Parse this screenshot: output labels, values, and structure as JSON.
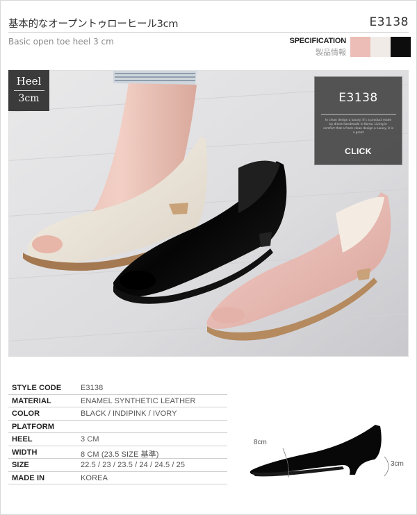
{
  "header": {
    "title_jp": "基本的なオープントゥローヒール3cm",
    "code": "E3138",
    "title_en": "Basic open toe heel 3 cm"
  },
  "specification": {
    "label_en": "SPECIFICATION",
    "label_jp": "製品情報",
    "swatches": [
      "#ecbcb6",
      "#f1ebe8",
      "#0d0d0d"
    ]
  },
  "photo": {
    "heel_badge": {
      "line1": "Heel",
      "line2": "3cm"
    },
    "panel": {
      "code": "E3138",
      "small_text": "In clean design a luxury. It's a product made by direct handmade in Korea. Living in comfort that a fresh clean design a luxury, it is a great",
      "click_label": "CLICK"
    }
  },
  "spec_table": [
    {
      "key": "STYLE CODE",
      "value": "E3138"
    },
    {
      "key": "MATERIAL",
      "value": "ENAMEL SYNTHETIC LEATHER"
    },
    {
      "key": "COLOR",
      "value": "BLACK / INDIPINK / IVORY"
    },
    {
      "key": "PLATFORM",
      "value": ""
    },
    {
      "key": "HEEL",
      "value": "3 CM"
    },
    {
      "key": "WIDTH",
      "value": "8 CM (23.5 SIZE 基準)"
    },
    {
      "key": "SIZE",
      "value": "22.5 / 23 / 23.5 / 24 / 24.5 / 25"
    },
    {
      "key": "MADE IN",
      "value": "KOREA"
    }
  ],
  "diagram": {
    "width_label": "8cm",
    "heel_label": "3cm"
  }
}
